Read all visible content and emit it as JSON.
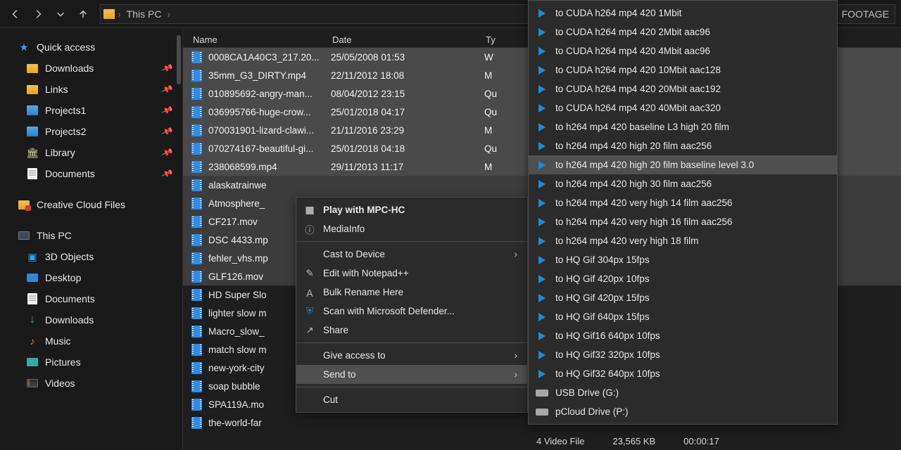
{
  "breadcrumb": {
    "pc": "This PC",
    "last": "FOOTAGE"
  },
  "sidebar": {
    "quick": {
      "label": "Quick access"
    },
    "downloads": {
      "label": "Downloads"
    },
    "links": {
      "label": "Links"
    },
    "proj1": {
      "label": "Projects1"
    },
    "proj2": {
      "label": "Projects2"
    },
    "library": {
      "label": "Library"
    },
    "documents": {
      "label": "Documents"
    },
    "cc": {
      "label": "Creative Cloud Files"
    },
    "thispc": {
      "label": "This PC"
    },
    "obj3d": {
      "label": "3D Objects"
    },
    "desktop": {
      "label": "Desktop"
    },
    "docs2": {
      "label": "Documents"
    },
    "downloads2": {
      "label": "Downloads"
    },
    "music": {
      "label": "Music"
    },
    "pictures": {
      "label": "Pictures"
    },
    "videos": {
      "label": "Videos"
    }
  },
  "columns": {
    "name": "Name",
    "date": "Date",
    "type": "Ty"
  },
  "files": [
    {
      "name": "0008CA1A40C3_217.20...",
      "date": "25/05/2008 01:53",
      "type": "W",
      "sel": "sel"
    },
    {
      "name": "35mm_G3_DIRTY.mp4",
      "date": "22/11/2012 18:08",
      "type": "M",
      "sel": "sel"
    },
    {
      "name": "010895692-angry-man...",
      "date": "08/04/2012 23:15",
      "type": "Qu",
      "sel": "sel"
    },
    {
      "name": "036995766-huge-crow...",
      "date": "25/01/2018 04:17",
      "type": "Qu",
      "sel": "sel"
    },
    {
      "name": "070031901-lizard-clawi...",
      "date": "21/11/2016 23:29",
      "type": "M",
      "sel": "sel"
    },
    {
      "name": "070274167-beautiful-gi...",
      "date": "25/01/2018 04:18",
      "type": "Qu",
      "sel": "sel"
    },
    {
      "name": "238068599.mp4",
      "date": "29/11/2013 11:17",
      "type": "M",
      "sel": "sel"
    },
    {
      "name": "alaskatrainwe",
      "date": "",
      "type": "",
      "sel": "sellight"
    },
    {
      "name": "Atmosphere_",
      "date": "",
      "type": "",
      "sel": "sellight"
    },
    {
      "name": "CF217.mov",
      "date": "",
      "type": "",
      "sel": "sellight"
    },
    {
      "name": "DSC 4433.mp",
      "date": "",
      "type": "",
      "sel": "sellight"
    },
    {
      "name": "fehler_vhs.mp",
      "date": "",
      "type": "",
      "sel": "sellight"
    },
    {
      "name": "GLF126.mov",
      "date": "",
      "type": "",
      "sel": "sellight"
    },
    {
      "name": "HD Super Slo",
      "date": "",
      "type": "",
      "sel": ""
    },
    {
      "name": "lighter slow m",
      "date": "",
      "type": "",
      "sel": ""
    },
    {
      "name": "Macro_slow_",
      "date": "",
      "type": "",
      "sel": ""
    },
    {
      "name": "match slow m",
      "date": "",
      "type": "",
      "sel": ""
    },
    {
      "name": "new-york-city",
      "date": "",
      "type": "",
      "sel": ""
    },
    {
      "name": "soap bubble",
      "date": "",
      "type": "",
      "sel": ""
    },
    {
      "name": "SPA119A.mo",
      "date": "",
      "type": "",
      "sel": ""
    },
    {
      "name": "the-world-far",
      "date": "",
      "type": "",
      "sel": ""
    }
  ],
  "ctx": {
    "play": "Play with MPC-HC",
    "mediainfo": "MediaInfo",
    "cast": "Cast to Device",
    "notepad": "Edit with Notepad++",
    "bulk": "Bulk Rename Here",
    "defender": "Scan with Microsoft Defender...",
    "share": "Share",
    "giveaccess": "Give access to",
    "sendto": "Send to",
    "cut": "Cut"
  },
  "submenu": [
    "to CUDA h264 mp4 420 1Mbit",
    "to CUDA h264 mp4 420 2Mbit aac96",
    "to CUDA h264 mp4 420 4Mbit aac96",
    "to CUDA h264 mp4 420 10Mbit aac128",
    "to CUDA h264 mp4 420 20Mbit aac192",
    "to CUDA h264 mp4 420 40Mbit aac320",
    "to h264 mp4 420 baseline L3 high 20 film",
    "to h264 mp4 420 high 20 film aac256",
    "to h264 mp4 420 high 20 film baseline level 3.0",
    "to h264 mp4 420 high 30 film aac256",
    "to h264 mp4 420 very high 14 film aac256",
    "to h264 mp4 420 very high 16 film aac256",
    "to h264 mp4 420 very high 18 film",
    "to HQ Gif 304px 15fps",
    "to HQ Gif 420px 10fps",
    "to HQ Gif 420px 15fps",
    "to HQ Gif 640px 15fps",
    "to HQ Gif16 640px 10fps",
    "to HQ Gif32 320px 10fps",
    "to HQ Gif32 640px 10fps"
  ],
  "submenu_hover_index": 8,
  "drives": {
    "g": "USB Drive (G:)",
    "p": "pCloud Drive (P:)"
  },
  "bottom": {
    "type": "4 Video File",
    "size": "23,565 KB",
    "dur": "00:00:17"
  }
}
